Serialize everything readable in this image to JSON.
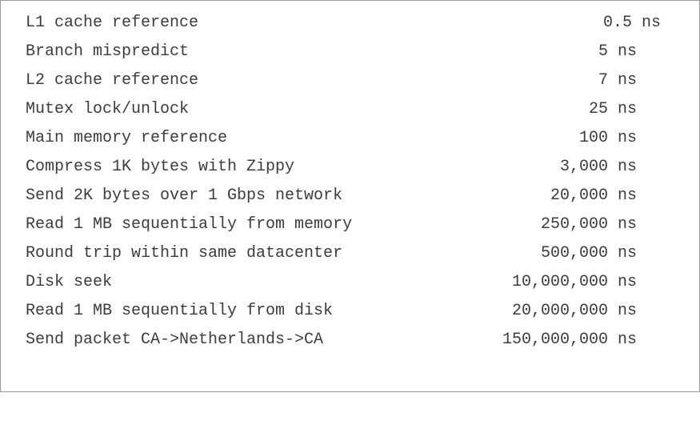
{
  "rows": [
    {
      "operation": "L1 cache reference",
      "latency": "0.5 ns"
    },
    {
      "operation": "Branch mispredict",
      "latency": "5 ns"
    },
    {
      "operation": "L2 cache reference",
      "latency": "7 ns"
    },
    {
      "operation": "Mutex lock/unlock",
      "latency": "25 ns"
    },
    {
      "operation": "Main memory reference",
      "latency": "100 ns"
    },
    {
      "operation": "Compress 1K bytes with Zippy",
      "latency": "3,000 ns"
    },
    {
      "operation": "Send 2K bytes over 1 Gbps network",
      "latency": "20,000 ns"
    },
    {
      "operation": "Read 1 MB sequentially from memory",
      "latency": "250,000 ns"
    },
    {
      "operation": "Round trip within same datacenter",
      "latency": "500,000 ns"
    },
    {
      "operation": "Disk seek",
      "latency": "10,000,000 ns"
    },
    {
      "operation": "Read 1 MB sequentially from disk",
      "latency": "20,000,000 ns"
    },
    {
      "operation": "Send packet CA->Netherlands->CA",
      "latency": "150,000,000 ns"
    }
  ]
}
